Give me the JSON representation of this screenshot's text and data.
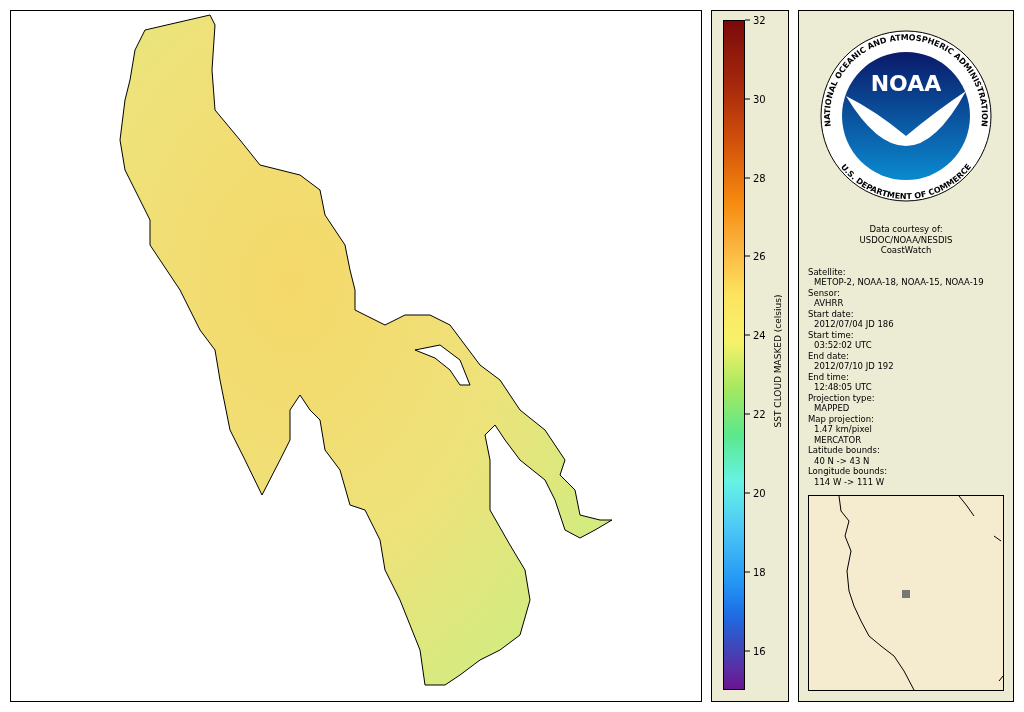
{
  "colorbar": {
    "label": "SST CLOUD MASKED (celsius)",
    "ticks": [
      "32",
      "30",
      "28",
      "26",
      "24",
      "22",
      "20",
      "18",
      "16"
    ]
  },
  "logo": {
    "acronym": "NOAA",
    "agency": "NATIONAL OCEANIC AND ATMOSPHERIC ADMINISTRATION",
    "department": "U.S. DEPARTMENT OF COMMERCE"
  },
  "credits": [
    "Data courtesy of:",
    "USDOC/NOAA/NESDIS",
    "CoastWatch"
  ],
  "metadata": [
    {
      "label": "Satellite:",
      "values": [
        "METOP-2, NOAA-18, NOAA-15, NOAA-19"
      ]
    },
    {
      "label": "Sensor:",
      "values": [
        "AVHRR"
      ]
    },
    {
      "label": "Start date:",
      "values": [
        "2012/07/04 JD 186"
      ]
    },
    {
      "label": "Start time:",
      "values": [
        "03:52:02 UTC"
      ]
    },
    {
      "label": "End date:",
      "values": [
        "2012/07/10 JD 192"
      ]
    },
    {
      "label": "End time:",
      "values": [
        "12:48:05 UTC"
      ]
    },
    {
      "label": "Projection type:",
      "values": [
        "MAPPED"
      ]
    },
    {
      "label": "Map projection:",
      "values": [
        "1.47 km/pixel",
        "MERCATOR"
      ]
    },
    {
      "label": "Latitude bounds:",
      "values": [
        "40 N -> 43 N"
      ]
    },
    {
      "label": "Longitude bounds:",
      "values": [
        "114 W -> 111 W"
      ]
    }
  ]
}
